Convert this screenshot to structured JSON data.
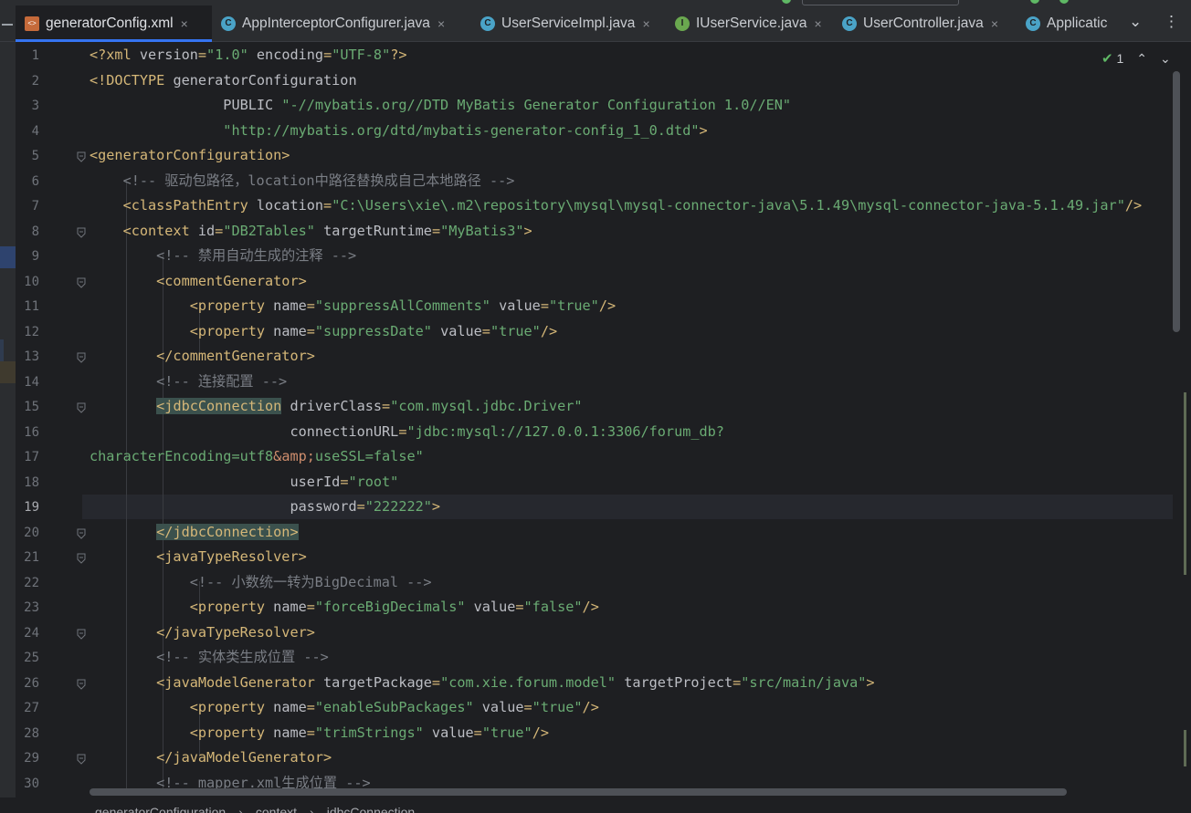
{
  "tabs": [
    {
      "label": "generatorConfig.xml",
      "icon": "xml-file-icon",
      "active": true
    },
    {
      "label": "AppInterceptorConfigurer.java",
      "icon": "java-class-icon"
    },
    {
      "label": "UserServiceImpl.java",
      "icon": "java-class-icon"
    },
    {
      "label": "IUserService.java",
      "icon": "java-interface-icon"
    },
    {
      "label": "UserController.java",
      "icon": "java-class-icon"
    },
    {
      "label": "Applicatic",
      "icon": "java-class-icon"
    }
  ],
  "tab_close_glyph": "×",
  "tab_more_glyph": "⌄",
  "tab_menu_glyph": "⋮",
  "inspection": {
    "count": "1",
    "up": "⌃",
    "down": "⌄"
  },
  "current_line": 19,
  "lines": [
    [
      [
        "t",
        "<?xml "
      ],
      [
        "a",
        "version"
      ],
      [
        "t",
        "="
      ],
      [
        "v",
        "\"1.0\""
      ],
      [
        "a",
        " encoding"
      ],
      [
        "t",
        "="
      ],
      [
        "v",
        "\"UTF-8\""
      ],
      [
        "t",
        "?>"
      ]
    ],
    [
      [
        "t",
        "<!DOCTYPE "
      ],
      [
        "a",
        "generatorConfiguration"
      ]
    ],
    [
      [
        "a",
        "                PUBLIC "
      ],
      [
        "v",
        "\"-//mybatis.org//DTD MyBatis Generator Configuration 1.0//EN\""
      ]
    ],
    [
      [
        "v",
        "                \"http://mybatis.org/dtd/mybatis-generator-config_1_0.dtd\""
      ],
      [
        "t",
        ">"
      ]
    ],
    [
      [
        "t",
        "<generatorConfiguration>"
      ]
    ],
    [
      [
        "c",
        "    <!-- 驱动包路径，location中路径替换成自己本地路径 -->"
      ]
    ],
    [
      [
        "t",
        "    <classPathEntry "
      ],
      [
        "a",
        "location"
      ],
      [
        "t",
        "="
      ],
      [
        "v",
        "\"C:\\Users\\xie\\.m2\\repository\\mysql\\mysql-connector-java\\5.1.49\\mysql-connector-java-5.1.49.jar\""
      ],
      [
        "t",
        "/>"
      ]
    ],
    [
      [
        "t",
        "    <context "
      ],
      [
        "a",
        "id"
      ],
      [
        "t",
        "="
      ],
      [
        "v",
        "\"DB2Tables\""
      ],
      [
        "a",
        " targetRuntime"
      ],
      [
        "t",
        "="
      ],
      [
        "v",
        "\"MyBatis3\""
      ],
      [
        "t",
        ">"
      ]
    ],
    [
      [
        "c",
        "        <!-- 禁用自动生成的注释 -->"
      ]
    ],
    [
      [
        "t",
        "        <commentGenerator>"
      ]
    ],
    [
      [
        "t",
        "            <property "
      ],
      [
        "a",
        "name"
      ],
      [
        "t",
        "="
      ],
      [
        "v",
        "\"suppressAllComments\""
      ],
      [
        "a",
        " value"
      ],
      [
        "t",
        "="
      ],
      [
        "v",
        "\"true\""
      ],
      [
        "t",
        "/>"
      ]
    ],
    [
      [
        "t",
        "            <property "
      ],
      [
        "a",
        "name"
      ],
      [
        "t",
        "="
      ],
      [
        "v",
        "\"suppressDate\""
      ],
      [
        "a",
        " value"
      ],
      [
        "t",
        "="
      ],
      [
        "v",
        "\"true\""
      ],
      [
        "t",
        "/>"
      ]
    ],
    [
      [
        "t",
        "        </commentGenerator>"
      ]
    ],
    [
      [
        "c",
        "        <!-- 连接配置 -->"
      ]
    ],
    [
      [
        "a",
        "        "
      ],
      [
        "th",
        "<jdbcConnection"
      ],
      [
        "a",
        " driverClass"
      ],
      [
        "t",
        "="
      ],
      [
        "v",
        "\"com.mysql.jdbc.Driver\""
      ]
    ],
    [
      [
        "a",
        "                        connectionURL"
      ],
      [
        "t",
        "="
      ],
      [
        "v",
        "\"jdbc:mysql://127.0.0.1:3306/forum_db?"
      ]
    ],
    [
      [
        "v",
        "characterEncoding=utf8"
      ],
      [
        "e",
        "&amp;"
      ],
      [
        "v",
        "useSSL=false\""
      ]
    ],
    [
      [
        "a",
        "                        userId"
      ],
      [
        "t",
        "="
      ],
      [
        "v",
        "\"root\""
      ]
    ],
    [
      [
        "a",
        "                        password"
      ],
      [
        "t",
        "="
      ],
      [
        "v",
        "\"222222\""
      ],
      [
        "t",
        ">"
      ]
    ],
    [
      [
        "a",
        "        "
      ],
      [
        "th",
        "</jdbcConnection>"
      ]
    ],
    [
      [
        "t",
        "        <javaTypeResolver>"
      ]
    ],
    [
      [
        "c",
        "            <!-- 小数统一转为BigDecimal -->"
      ]
    ],
    [
      [
        "t",
        "            <property "
      ],
      [
        "a",
        "name"
      ],
      [
        "t",
        "="
      ],
      [
        "v",
        "\"forceBigDecimals\""
      ],
      [
        "a",
        " value"
      ],
      [
        "t",
        "="
      ],
      [
        "v",
        "\"false\""
      ],
      [
        "t",
        "/>"
      ]
    ],
    [
      [
        "t",
        "        </javaTypeResolver>"
      ]
    ],
    [
      [
        "c",
        "        <!-- 实体类生成位置 -->"
      ]
    ],
    [
      [
        "t",
        "        <javaModelGenerator "
      ],
      [
        "a",
        "targetPackage"
      ],
      [
        "t",
        "="
      ],
      [
        "v",
        "\"com.xie.forum.model\""
      ],
      [
        "a",
        " targetProject"
      ],
      [
        "t",
        "="
      ],
      [
        "v",
        "\"src/main/java\""
      ],
      [
        "t",
        ">"
      ]
    ],
    [
      [
        "t",
        "            <property "
      ],
      [
        "a",
        "name"
      ],
      [
        "t",
        "="
      ],
      [
        "v",
        "\"enableSubPackages\""
      ],
      [
        "a",
        " value"
      ],
      [
        "t",
        "="
      ],
      [
        "v",
        "\"true\""
      ],
      [
        "t",
        "/>"
      ]
    ],
    [
      [
        "t",
        "            <property "
      ],
      [
        "a",
        "name"
      ],
      [
        "t",
        "="
      ],
      [
        "v",
        "\"trimStrings\""
      ],
      [
        "a",
        " value"
      ],
      [
        "t",
        "="
      ],
      [
        "v",
        "\"true\""
      ],
      [
        "t",
        "/>"
      ]
    ],
    [
      [
        "t",
        "        </javaModelGenerator>"
      ]
    ],
    [
      [
        "c",
        "        <!-- mapper.xml生成位置 -->"
      ]
    ]
  ],
  "breadcrumb": [
    "generatorConfiguration",
    "context",
    "jdbcConnection"
  ],
  "breadcrumb_sep": "›",
  "colors": {
    "tag": "#d5b778",
    "attr": "#bcbec4",
    "value": "#6aab73",
    "comment": "#7a7e85",
    "entity": "#cf8e6d",
    "accent": "#3574f0"
  }
}
